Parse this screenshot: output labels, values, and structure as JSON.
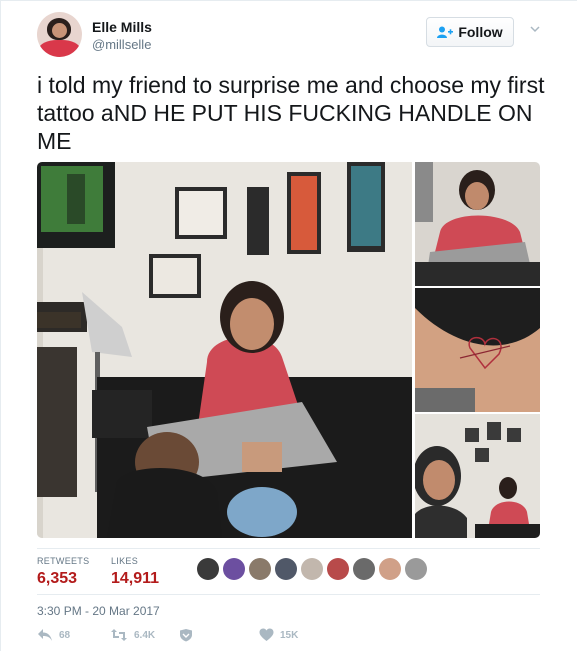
{
  "user": {
    "display_name": "Elle Mills",
    "handle": "@millselle",
    "avatar_icon": "profile-photo"
  },
  "follow_button": {
    "label": "Follow",
    "icon": "add-user-icon"
  },
  "menu_icon": "chevron-down-icon",
  "tweet": {
    "text": "i told my friend to surprise me and choose my first tattoo aND HE PUT HIS FUCKING HANDLE ON ME"
  },
  "media": {
    "main_photo": "tattoo-studio-photo",
    "thumbnails": [
      "tattoo-session-photo",
      "ankle-tattoo-photo",
      "selfie-photo"
    ]
  },
  "stats": {
    "retweets_label": "RETWEETS",
    "retweets_value": "6,353",
    "likes_label": "LIKES",
    "likes_value": "14,911"
  },
  "timestamp": "3:30 PM - 20 Mar 2017",
  "actions": {
    "reply_count": "68",
    "retweet_count": "6.4K",
    "like_count": "15K"
  },
  "colors": {
    "stat_value": "#b31b1b",
    "muted": "#657786",
    "action_icon": "#aab8c2",
    "follow_icon": "#1da1f2"
  }
}
